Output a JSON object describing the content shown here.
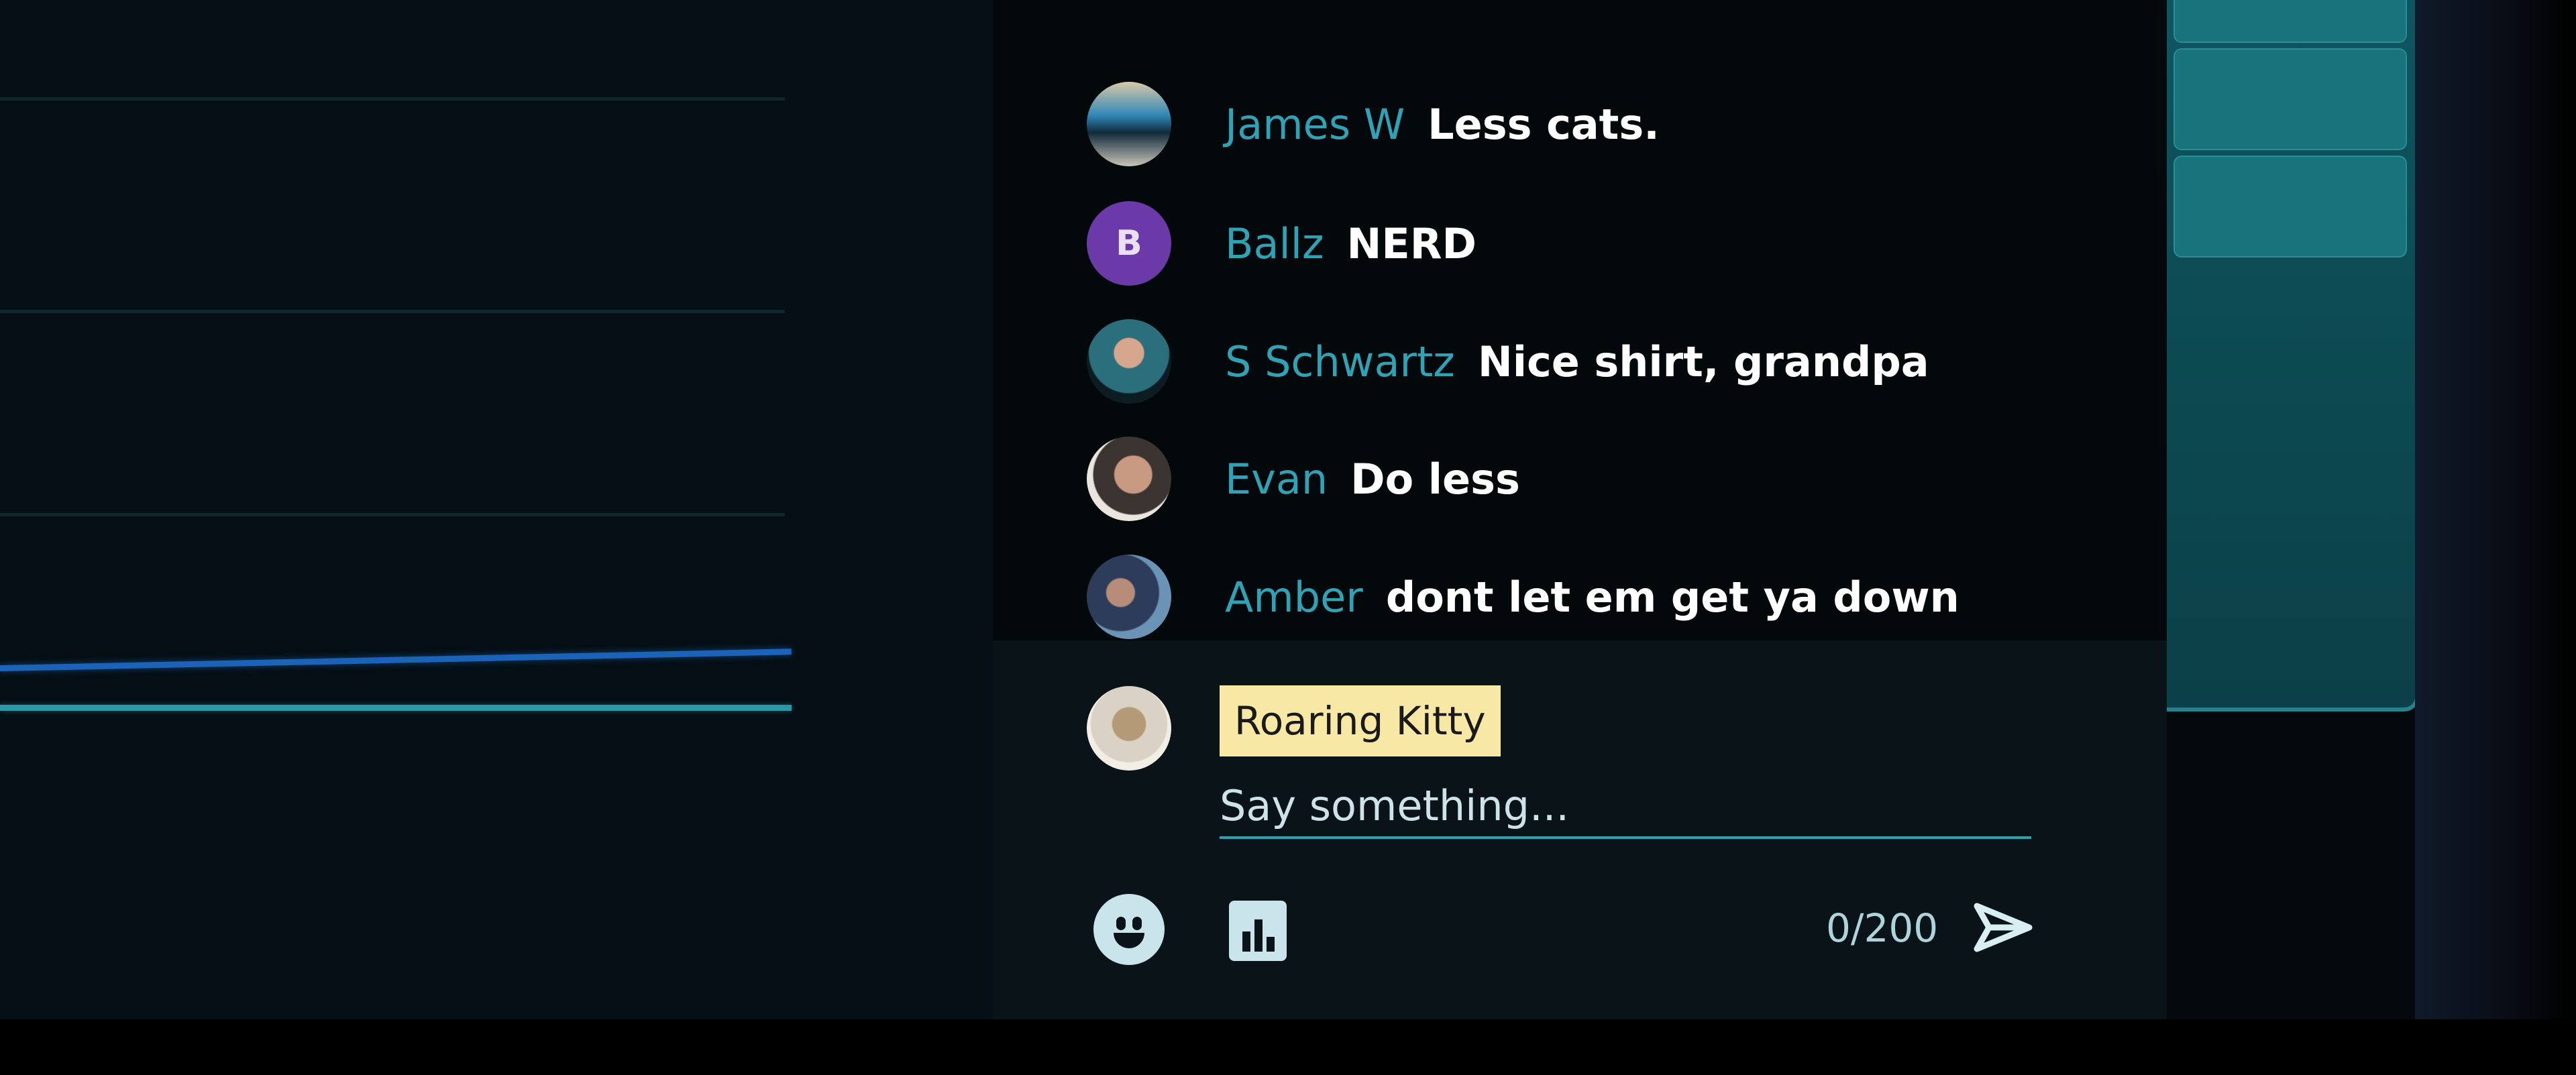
{
  "chat": {
    "messages": [
      {
        "author": "James W",
        "text": "Less cats."
      },
      {
        "author": "Ballz",
        "text": "NERD",
        "avatar_letter": "B"
      },
      {
        "author": "S Schwartz",
        "text": "Nice shirt, grandpa"
      },
      {
        "author": "Evan",
        "text": "Do less"
      },
      {
        "author": "Amber",
        "text": "dont let em get ya down"
      }
    ],
    "compose": {
      "username": "Roaring Kitty",
      "placeholder": "Say something...",
      "char_counter": "0/200"
    }
  },
  "icons": {
    "emoji": "smiley-icon",
    "poll": "bar-chart-icon",
    "send": "send-arrow-icon"
  },
  "colors": {
    "author_name": "#2fa3b5",
    "message_text": "#ffffff",
    "username_badge": "#f7e8a6",
    "avatar_letter_bg": "#6b3aa8",
    "accent_teal": "#2aa0b3",
    "series_blue": "#1a63b8"
  }
}
